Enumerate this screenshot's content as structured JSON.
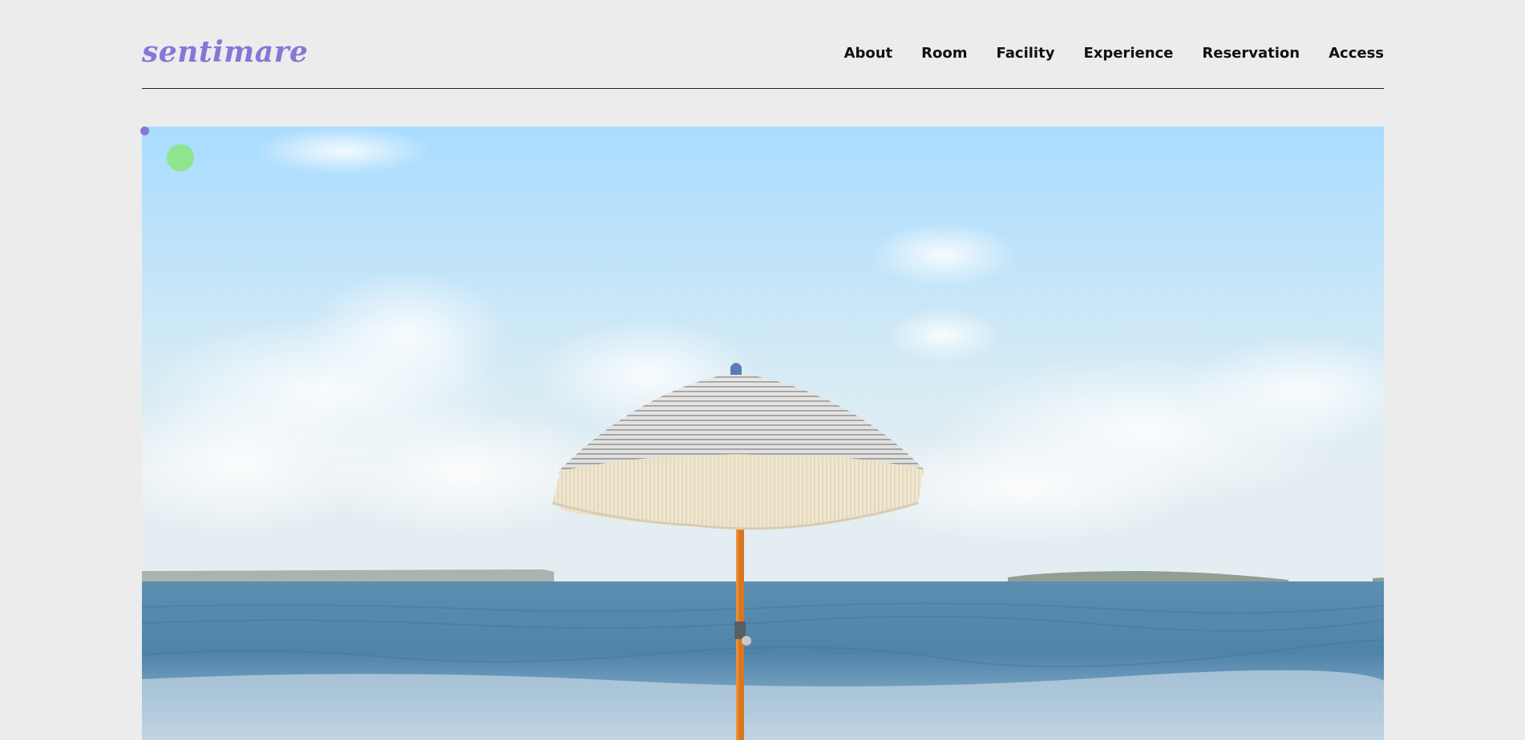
{
  "header": {
    "logo": "sentimare",
    "nav": [
      {
        "label": "About"
      },
      {
        "label": "Room"
      },
      {
        "label": "Facility"
      },
      {
        "label": "Experience"
      },
      {
        "label": "Reservation"
      },
      {
        "label": "Access"
      }
    ]
  },
  "hero": {
    "image": "beach-umbrella-photo"
  },
  "colors": {
    "brand": "#8577d8",
    "background": "#ececec",
    "accent_dot": "#8ee58e"
  }
}
